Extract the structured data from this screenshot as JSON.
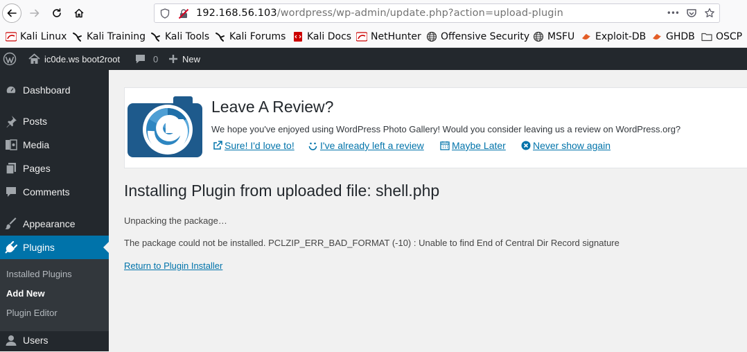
{
  "browser": {
    "url_host": "192.168.56.103",
    "url_path": "/wordpress/wp-admin/update.php?action=upload-plugin",
    "more_glyph": "•••"
  },
  "bookmarks": [
    {
      "label": "Kali Linux",
      "icon": "kali-dragon-icon"
    },
    {
      "label": "Kali Training",
      "icon": "kali-training-icon"
    },
    {
      "label": "Kali Tools",
      "icon": "kali-tools-icon"
    },
    {
      "label": "Kali Forums",
      "icon": "kali-forums-icon"
    },
    {
      "label": "Kali Docs",
      "icon": "kali-docs-icon"
    },
    {
      "label": "NetHunter",
      "icon": "nethunter-icon"
    },
    {
      "label": "Offensive Security",
      "icon": "globe-icon"
    },
    {
      "label": "MSFU",
      "icon": "globe-icon"
    },
    {
      "label": "Exploit-DB",
      "icon": "exploitdb-icon"
    },
    {
      "label": "GHDB",
      "icon": "ghdb-icon"
    },
    {
      "label": "OSCP",
      "icon": "folder-icon"
    }
  ],
  "adminbar": {
    "site_name": "ic0de.ws boot2root",
    "comments_count": "0",
    "new_label": "New"
  },
  "sidebar": {
    "items": [
      {
        "label": "Dashboard",
        "icon": "dashboard-icon"
      },
      {
        "label": "Posts",
        "icon": "pin-icon"
      },
      {
        "label": "Media",
        "icon": "media-icon"
      },
      {
        "label": "Pages",
        "icon": "pages-icon"
      },
      {
        "label": "Comments",
        "icon": "comments-icon"
      },
      {
        "label": "Appearance",
        "icon": "brush-icon"
      },
      {
        "label": "Plugins",
        "icon": "plugin-icon"
      },
      {
        "label": "Users",
        "icon": "users-icon"
      }
    ],
    "submenu": [
      "Installed Plugins",
      "Add New",
      "Plugin Editor"
    ]
  },
  "notice": {
    "title": "Leave A Review?",
    "text": "We hope you've enjoyed using WordPress Photo Gallery! Would you consider leaving us a review on WordPress.org?",
    "links": [
      "Sure! I'd love to!",
      "I've already left a review",
      "Maybe Later",
      "Never show again"
    ]
  },
  "content": {
    "heading": "Installing Plugin from uploaded file: shell.php",
    "unpacking": "Unpacking the package…",
    "error": "The package could not be installed. PCLZIP_ERR_BAD_FORMAT (-10) : Unable to find End of Central Dir Record signature",
    "return_link": "Return to Plugin Installer"
  },
  "colors": {
    "admin_dark": "#23282d",
    "admin_blue": "#0073aa",
    "link": "#0073aa"
  }
}
